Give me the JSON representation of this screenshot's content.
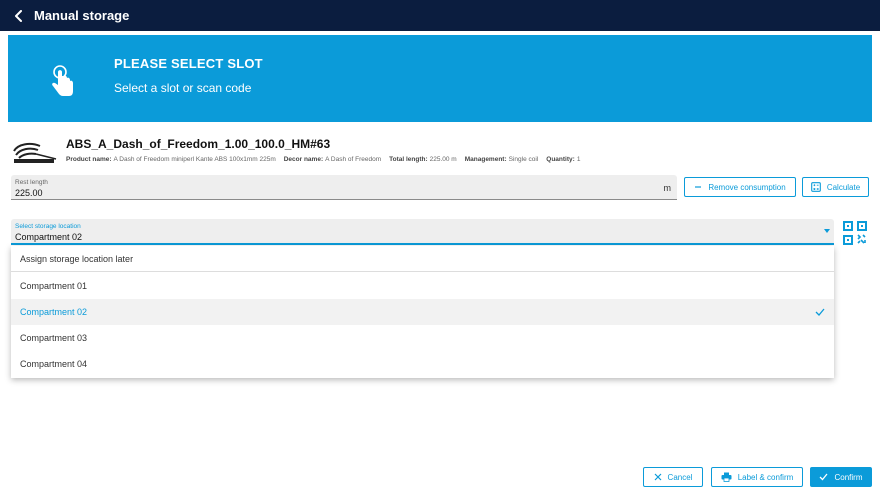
{
  "header": {
    "title": "Manual storage",
    "back_icon": "chevron-left-icon"
  },
  "banner": {
    "title": "PLEASE SELECT SLOT",
    "subtitle": "Select a slot or scan code",
    "icon": "touch-hand-icon"
  },
  "product": {
    "title": "ABS_A_Dash_of_Freedom_1.00_100.0_HM#63",
    "icon": "edge-band-roll-icon",
    "meta": [
      {
        "label": "Product name:",
        "value": "A Dash of Freedom miniperl Kante ABS 100x1mm 225m"
      },
      {
        "label": "Decor name:",
        "value": "A Dash of Freedom"
      },
      {
        "label": "Total length:",
        "value": "225.00 m"
      },
      {
        "label": "Management:",
        "value": "Single coil"
      },
      {
        "label": "Quantity:",
        "value": "1"
      }
    ]
  },
  "rest_length": {
    "label": "Rest length",
    "value": "225.00",
    "unit": "m"
  },
  "buttons": {
    "remove_consumption": "Remove consumption",
    "calculate": "Calculate"
  },
  "storage_location": {
    "label": "Select storage location",
    "value": "Compartment 02",
    "options": [
      {
        "label": "Assign storage location later",
        "selected": false
      },
      {
        "label": "Compartment 01",
        "selected": false
      },
      {
        "label": "Compartment 02",
        "selected": true
      },
      {
        "label": "Compartment 03",
        "selected": false
      },
      {
        "label": "Compartment 04",
        "selected": false
      }
    ]
  },
  "footer": {
    "cancel": "Cancel",
    "label_confirm": "Label & confirm",
    "confirm": "Confirm"
  },
  "colors": {
    "accent": "#0b9bd9",
    "header_bg": "#0b1d3f"
  }
}
